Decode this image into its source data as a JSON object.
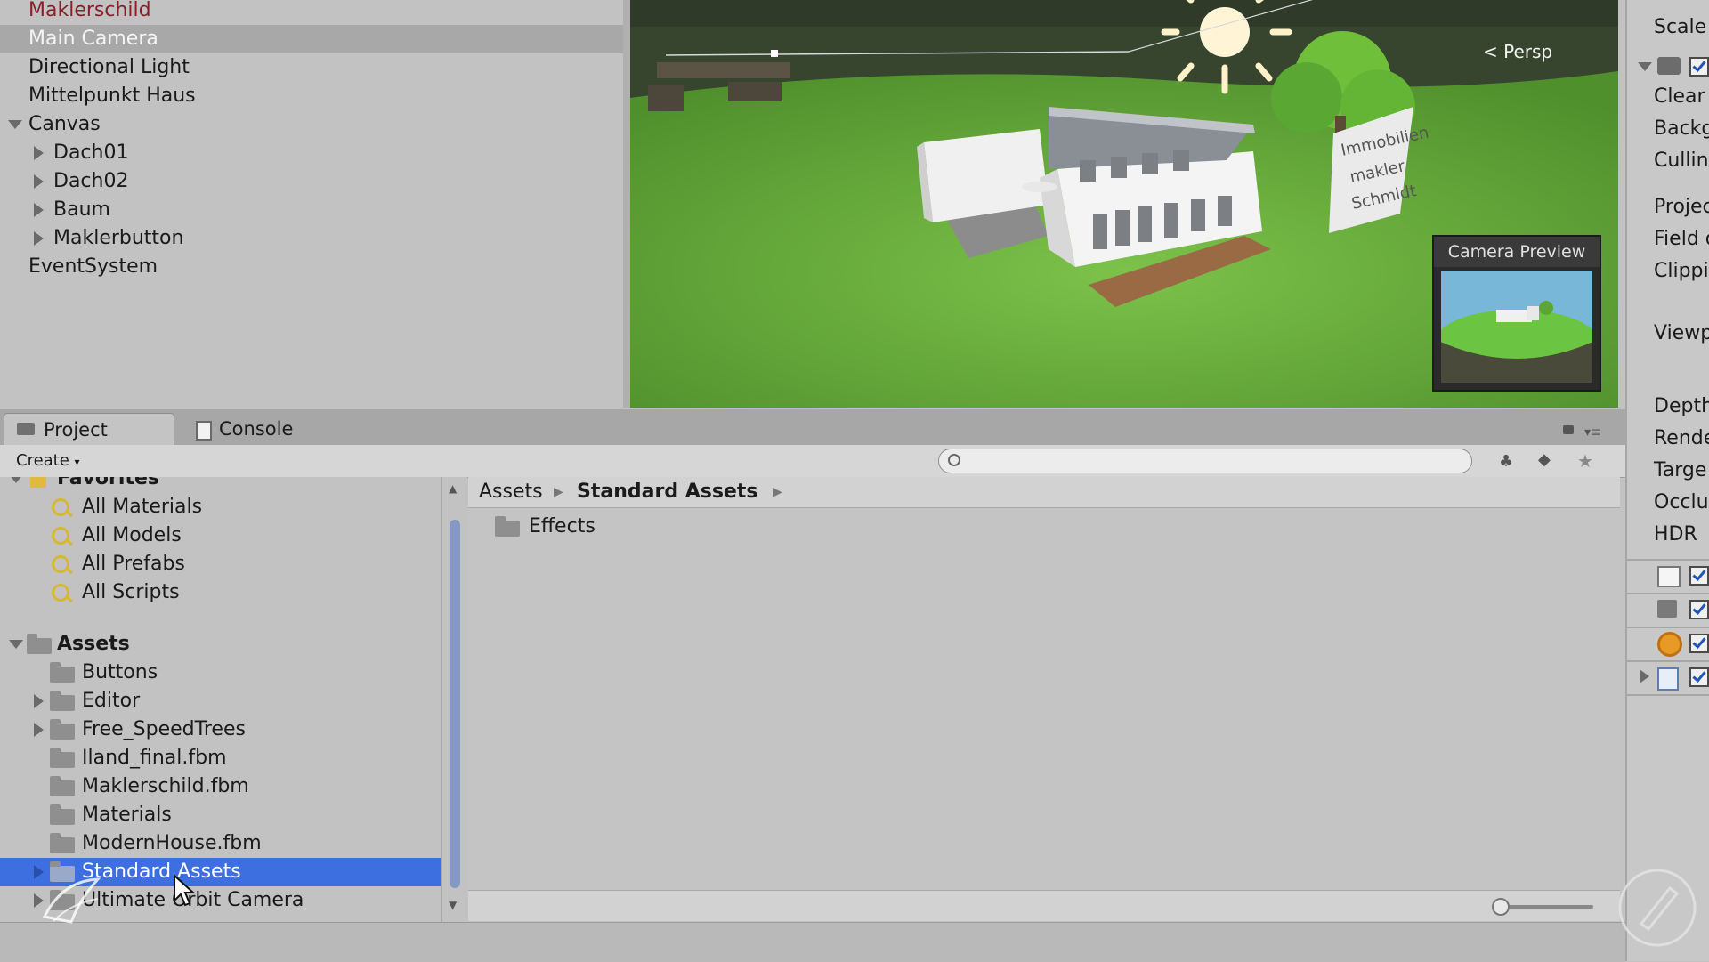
{
  "hierarchy": {
    "items": [
      {
        "label": "Maklerschild",
        "state": "prefab"
      },
      {
        "label": "Main Camera",
        "state": "selected"
      },
      {
        "label": "Directional Light"
      },
      {
        "label": "Mittelpunkt Haus"
      },
      {
        "label": "Canvas",
        "expand": "open"
      },
      {
        "label": "Dach01",
        "expand": "closed"
      },
      {
        "label": "Dach02",
        "expand": "closed"
      },
      {
        "label": "Baum",
        "expand": "closed"
      },
      {
        "label": "Maklerbutton",
        "expand": "closed"
      },
      {
        "label": "EventSystem"
      }
    ]
  },
  "scene": {
    "persp_label": "Persp",
    "camera_preview_title": "Camera Preview",
    "sign_text": [
      "Immobilien",
      "makler",
      "Schmidt"
    ]
  },
  "inspector": {
    "labels": [
      "Scale",
      "Clear",
      "Backg",
      "Cullin",
      "Projec",
      "Field o",
      "Clippi",
      "Viewp",
      "Depth",
      "Rende",
      "Targe",
      "Occlu",
      "HDR"
    ],
    "components": [
      "camera",
      "gui-layer",
      "flare-layer",
      "audio-listener",
      "script"
    ]
  },
  "project": {
    "tabs": {
      "project": "Project",
      "console": "Console"
    },
    "create_label": "Create",
    "search_placeholder": "",
    "favorites": {
      "header": "Favorites",
      "items": [
        "All Materials",
        "All Models",
        "All Prefabs",
        "All Scripts"
      ]
    },
    "assets": {
      "header": "Assets",
      "items": [
        {
          "label": "Buttons",
          "expand": "none"
        },
        {
          "label": "Editor",
          "expand": "closed"
        },
        {
          "label": "Free_SpeedTrees",
          "expand": "closed"
        },
        {
          "label": "Iland_final.fbm",
          "expand": "none"
        },
        {
          "label": "Maklerschild.fbm",
          "expand": "none"
        },
        {
          "label": "Materials",
          "expand": "none"
        },
        {
          "label": "ModernHouse.fbm",
          "expand": "none"
        },
        {
          "label": "Standard Assets",
          "expand": "closed",
          "selected": true
        },
        {
          "label": "Ultimate Orbit Camera",
          "expand": "closed"
        }
      ]
    },
    "breadcrumb": [
      "Assets",
      "Standard Assets"
    ],
    "content_items": [
      {
        "label": "Effects",
        "icon": "folder"
      }
    ],
    "zoom_level": 0.0
  },
  "colors": {
    "selection_blue": "#3d6fe0",
    "prefab_red": "#8a1f2a",
    "panel_gray": "#c2c2c2",
    "favorites_yellow": "#d7b733"
  }
}
